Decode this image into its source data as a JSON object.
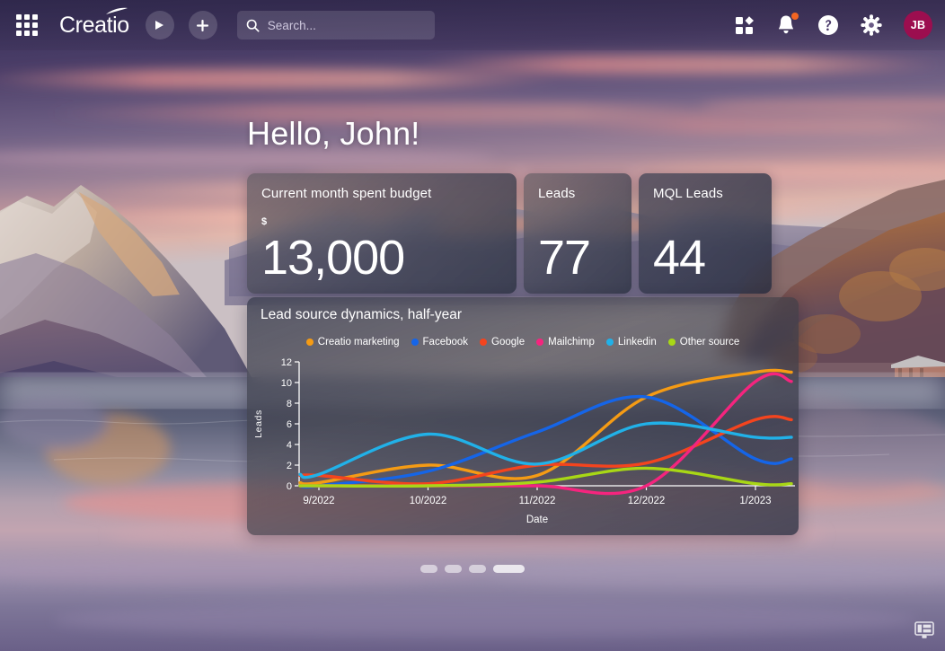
{
  "header": {
    "apps_icon": "apps-grid-icon",
    "brand": "Creatio",
    "play_icon": "play-icon",
    "add_icon": "plus-icon",
    "search": {
      "icon": "search-icon",
      "value": "",
      "placeholder": "Search..."
    },
    "right_icons": [
      {
        "name": "dashboard-grid-icon",
        "label": "Dashboards"
      },
      {
        "name": "bell-icon",
        "label": "Notifications",
        "badge": true
      },
      {
        "name": "help-circle-icon",
        "label": "Help"
      },
      {
        "name": "gear-icon",
        "label": "Settings"
      }
    ],
    "avatar": {
      "initials": "JB",
      "color": "#9c0e4f"
    }
  },
  "dashboard": {
    "greeting": "Hello, John!",
    "kpis": [
      {
        "title": "Current month spent budget",
        "currency": "$",
        "value": "13,000"
      },
      {
        "title": "Leads",
        "currency": "",
        "value": "77"
      },
      {
        "title": "MQL Leads",
        "currency": "",
        "value": "44"
      }
    ],
    "chart_title": "Lead source dynamics, half-year",
    "pagination": {
      "count": 4,
      "active_index": 3
    },
    "corner_icon": "display-layout-icon"
  },
  "chart_data": {
    "type": "line",
    "title": "Lead source dynamics, half-year",
    "xlabel": "Date",
    "ylabel": "Leads",
    "ylim": [
      0,
      12
    ],
    "yticks": [
      0,
      2,
      4,
      6,
      8,
      10,
      12
    ],
    "categories": [
      "9/2022",
      "10/2022",
      "11/2022",
      "12/2022",
      "1/2023"
    ],
    "grid": false,
    "legend_position": "top-center",
    "series": [
      {
        "name": "Creatio marketing",
        "color": "#F59B14",
        "values": [
          0.3,
          2.0,
          1.0,
          8.6,
          11.0
        ]
      },
      {
        "name": "Facebook",
        "color": "#1565E8",
        "values": [
          0.0,
          1.4,
          5.2,
          8.6,
          2.6
        ]
      },
      {
        "name": "Google",
        "color": "#F4441E",
        "values": [
          1.0,
          0.2,
          2.0,
          2.2,
          6.4
        ]
      },
      {
        "name": "Mailchimp",
        "color": "#F5247E",
        "values": [
          0.0,
          0.0,
          0.0,
          0.0,
          10.1
        ]
      },
      {
        "name": "Linkedin",
        "color": "#21B1E8",
        "values": [
          1.1,
          5.0,
          2.1,
          6.0,
          4.7
        ]
      },
      {
        "name": "Other source",
        "color": "#A8D715",
        "values": [
          0.0,
          0.0,
          0.35,
          1.7,
          0.2
        ]
      }
    ]
  }
}
